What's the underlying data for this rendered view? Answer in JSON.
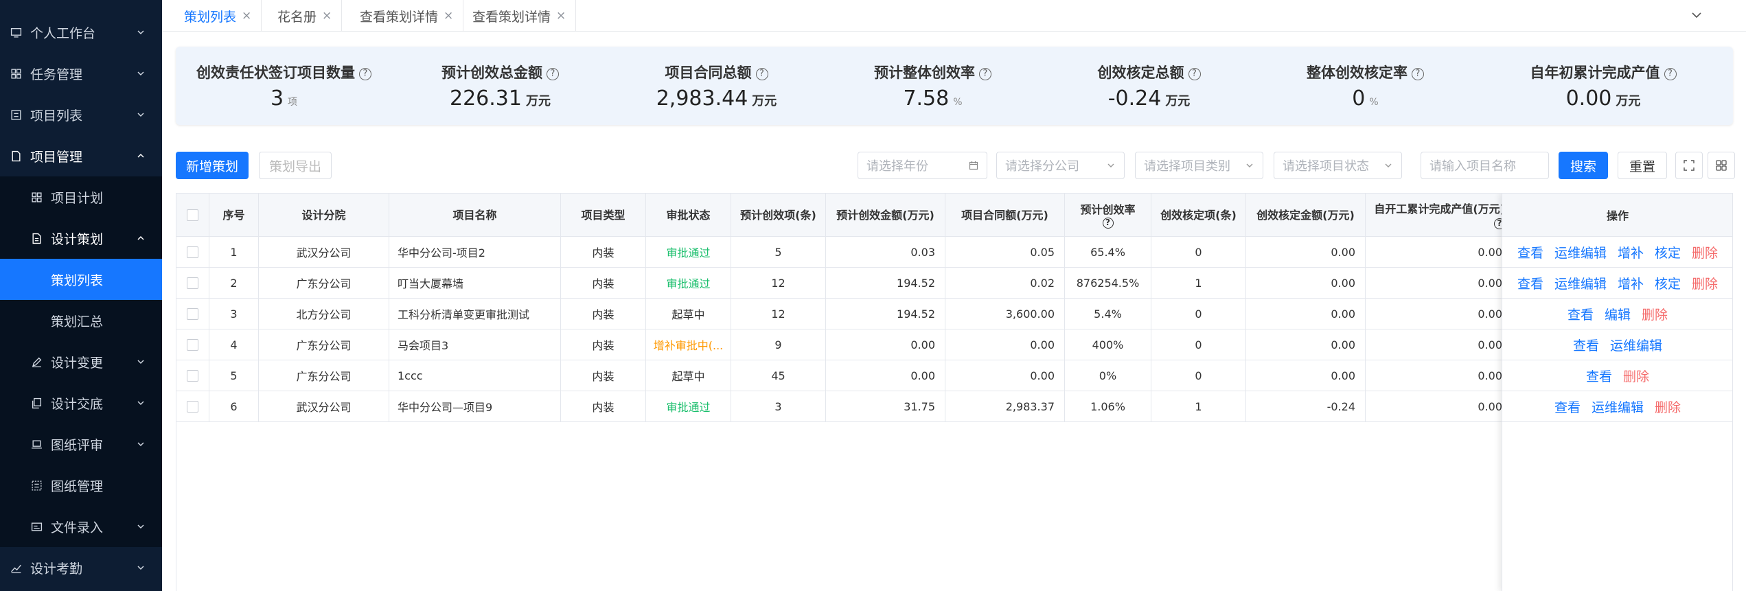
{
  "sidebar": {
    "items": [
      {
        "label": "个人工作台",
        "icon": "monitor-icon"
      },
      {
        "label": "任务管理",
        "icon": "grid-icon"
      },
      {
        "label": "项目列表",
        "icon": "list-icon"
      },
      {
        "label": "项目管理",
        "icon": "document-icon"
      },
      {
        "label": "项目计划",
        "icon": "grid-icon"
      },
      {
        "label": "设计策划",
        "icon": "file-icon"
      },
      {
        "label": "策划列表"
      },
      {
        "label": "策划汇总"
      },
      {
        "label": "设计变更",
        "icon": "edit-icon"
      },
      {
        "label": "设计交底",
        "icon": "copy-icon"
      },
      {
        "label": "图纸评审",
        "icon": "laptop-icon"
      },
      {
        "label": "图纸管理",
        "icon": "dotted-grid-icon"
      },
      {
        "label": "文件录入",
        "icon": "card-icon"
      },
      {
        "label": "设计考勤",
        "icon": "chart-icon"
      }
    ]
  },
  "tabs": [
    {
      "label": "策划列表",
      "active": true
    },
    {
      "label": "花名册",
      "active": false
    },
    {
      "label": "查看策划详情",
      "active": false
    },
    {
      "label": "查看策划详情",
      "active": false
    }
  ],
  "stats": [
    {
      "title": "创效责任状签订项目数量",
      "value": "3",
      "unit": "项"
    },
    {
      "title": "预计创效总金额",
      "value": "226.31",
      "unit": "万元"
    },
    {
      "title": "项目合同总额",
      "value": "2,983.44",
      "unit": "万元"
    },
    {
      "title": "预计整体创效率",
      "value": "7.58",
      "unit": "%"
    },
    {
      "title": "创效核定总额",
      "value": "-0.24",
      "unit": "万元"
    },
    {
      "title": "整体创效核定率",
      "value": "0",
      "unit": "%"
    },
    {
      "title": "自年初累计完成产值",
      "value": "0.00",
      "unit": "万元"
    }
  ],
  "toolbar": {
    "add_label": "新增策划",
    "export_label": "策划导出",
    "year_placeholder": "请选择年份",
    "branch_placeholder": "请选择分公司",
    "category_placeholder": "请选择项目类别",
    "status_placeholder": "请选择项目状态",
    "name_placeholder": "请输入项目名称",
    "search_label": "搜索",
    "reset_label": "重置"
  },
  "table": {
    "headers": {
      "no": "序号",
      "institute": "设计分院",
      "name": "项目名称",
      "type": "项目类型",
      "status": "审批状态",
      "items": "预计创效项(条)",
      "amount": "预计创效金额(万元)",
      "contract": "项目合同额(万元)",
      "rate": "预计创效率",
      "verified_items": "创效核定项(条)",
      "verified_amount": "创效核定金额(万元)",
      "output": "自开工累计完成产值(万元)",
      "ops": "操作"
    },
    "rows": [
      {
        "no": "1",
        "institute": "武汉分公司",
        "name": "华中分公司-项目2",
        "type": "内装",
        "status": "审批通过",
        "items": "5",
        "amount": "0.03",
        "contract": "0.05",
        "rate": "65.4%",
        "verified_items": "0",
        "verified_amount": "0.00",
        "output": "0.00"
      },
      {
        "no": "2",
        "institute": "广东分公司",
        "name": "叮当大厦幕墙",
        "type": "内装",
        "status": "审批通过",
        "items": "12",
        "amount": "194.52",
        "contract": "0.02",
        "rate": "876254.5%",
        "verified_items": "1",
        "verified_amount": "0.00",
        "output": "0.00"
      },
      {
        "no": "3",
        "institute": "北方分公司",
        "name": "工科分析清单变更审批测试",
        "type": "内装",
        "status": "起草中",
        "items": "12",
        "amount": "194.52",
        "contract": "3,600.00",
        "rate": "5.4%",
        "verified_items": "0",
        "verified_amount": "0.00",
        "output": "0.00"
      },
      {
        "no": "4",
        "institute": "广东分公司",
        "name": "马会项目3",
        "type": "内装",
        "status": "增补审批中(...",
        "items": "9",
        "amount": "0.00",
        "contract": "0.00",
        "rate": "400%",
        "verified_items": "0",
        "verified_amount": "0.00",
        "output": "0.00"
      },
      {
        "no": "5",
        "institute": "广东分公司",
        "name": "1ccc",
        "type": "内装",
        "status": "起草中",
        "items": "45",
        "amount": "0.00",
        "contract": "0.00",
        "rate": "0%",
        "verified_items": "0",
        "verified_amount": "0.00",
        "output": "0.00"
      },
      {
        "no": "6",
        "institute": "武汉分公司",
        "name": "华中分公司—项目9",
        "type": "内装",
        "status": "审批通过",
        "items": "3",
        "amount": "31.75",
        "contract": "2,983.37",
        "rate": "1.06%",
        "verified_items": "1",
        "verified_amount": "-0.24",
        "output": "0.00"
      }
    ],
    "ops": [
      [
        "查看",
        "运维编辑",
        "增补",
        "核定",
        "删除"
      ],
      [
        "查看",
        "运维编辑",
        "增补",
        "核定",
        "删除"
      ],
      [
        "查看",
        "编辑",
        "删除"
      ],
      [
        "查看",
        "运维编辑"
      ],
      [
        "查看",
        "删除"
      ],
      [
        "查看",
        "运维编辑",
        "删除"
      ]
    ]
  },
  "colors": {
    "sidebar_bg": "#0d1d33",
    "accent": "#1677ff",
    "success": "#19be6b",
    "warning": "#ff9900",
    "danger": "#f56c6c"
  }
}
